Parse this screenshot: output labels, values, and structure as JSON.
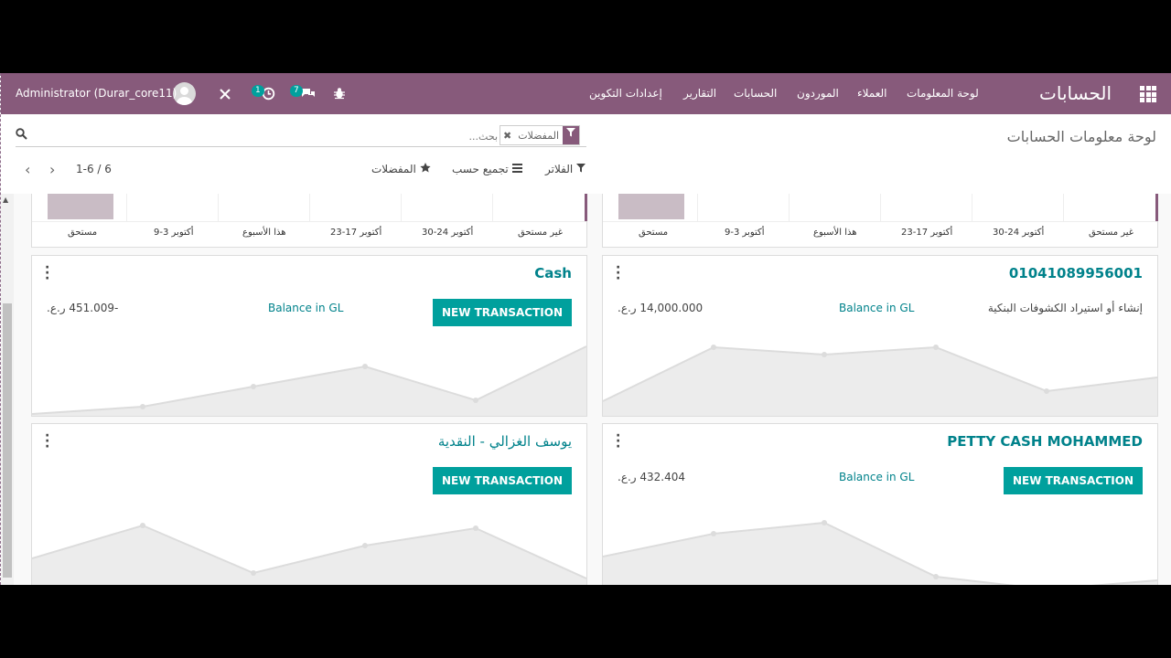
{
  "navbar": {
    "brand": "الحسابات",
    "menu": [
      "لوحة المعلومات",
      "العملاء",
      "الموردون",
      "الحسابات",
      "التقارير",
      "إعدادات التكوين"
    ],
    "activity_count": "1",
    "messages_count": "7",
    "user_name": "Administrator (Durar_core11)"
  },
  "control_panel": {
    "breadcrumb": "لوحة معلومات الحسابات",
    "facet_label": "المفضلات",
    "search_placeholder": "بحث...",
    "filters_label": "الفلاتر",
    "group_by_label": "تجميع حسب",
    "favorites_label": "المفضلات",
    "pager": "1-6 / 6"
  },
  "chart_ticks": [
    "مستحق",
    "9-3 أكتوبر",
    "هذا الأسبوع",
    "23-17 أكتوبر",
    "30-24 أكتوبر",
    "غير مستحق"
  ],
  "journals": {
    "cash": {
      "title": "Cash",
      "button": "NEW TRANSACTION",
      "balance_label": "Balance in GL",
      "balance_value": "-451.009 ر.ع."
    },
    "bank": {
      "title": "01041089956001",
      "action_text": "إنشاء أو استيراد الكشوفات البنكية",
      "balance_label": "Balance in GL",
      "balance_value": "14,000.000 ر.ع."
    },
    "yousef": {
      "title": "يوسف الغزالي - النقدية",
      "button": "NEW TRANSACTION"
    },
    "petty": {
      "title": "PETTY CASH MOHAMMED",
      "button": "NEW TRANSACTION",
      "balance_label": "Balance in GL",
      "balance_value": "432.404 ر.ع."
    }
  },
  "colors": {
    "brand": "#875a7b",
    "accent": "#00a09d",
    "link": "#00828b"
  }
}
